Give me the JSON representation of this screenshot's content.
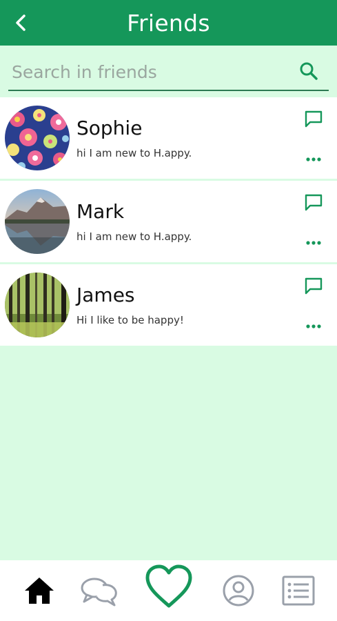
{
  "header": {
    "title": "Friends",
    "back_icon": "chevron-left-icon"
  },
  "search": {
    "placeholder": "Search in friends",
    "value": "",
    "icon": "search-icon"
  },
  "friends": [
    {
      "name": "Sophie",
      "status": "hi I am new to H.appy.",
      "avatar": "floral-pattern-avatar"
    },
    {
      "name": "Mark",
      "status": "hi I am new to H.appy.",
      "avatar": "mountain-lake-avatar"
    },
    {
      "name": "James",
      "status": "Hi I like to be happy!",
      "avatar": "forest-avatar"
    }
  ],
  "bottom_nav": {
    "items": [
      "home-icon",
      "chat-bubbles-icon",
      "heart-icon",
      "profile-icon",
      "list-icon"
    ],
    "active": "home-icon"
  },
  "colors": {
    "primary": "#15975a",
    "background": "#d9fbe3",
    "card": "#ffffff",
    "inactive_icon": "#9aa0aa"
  }
}
